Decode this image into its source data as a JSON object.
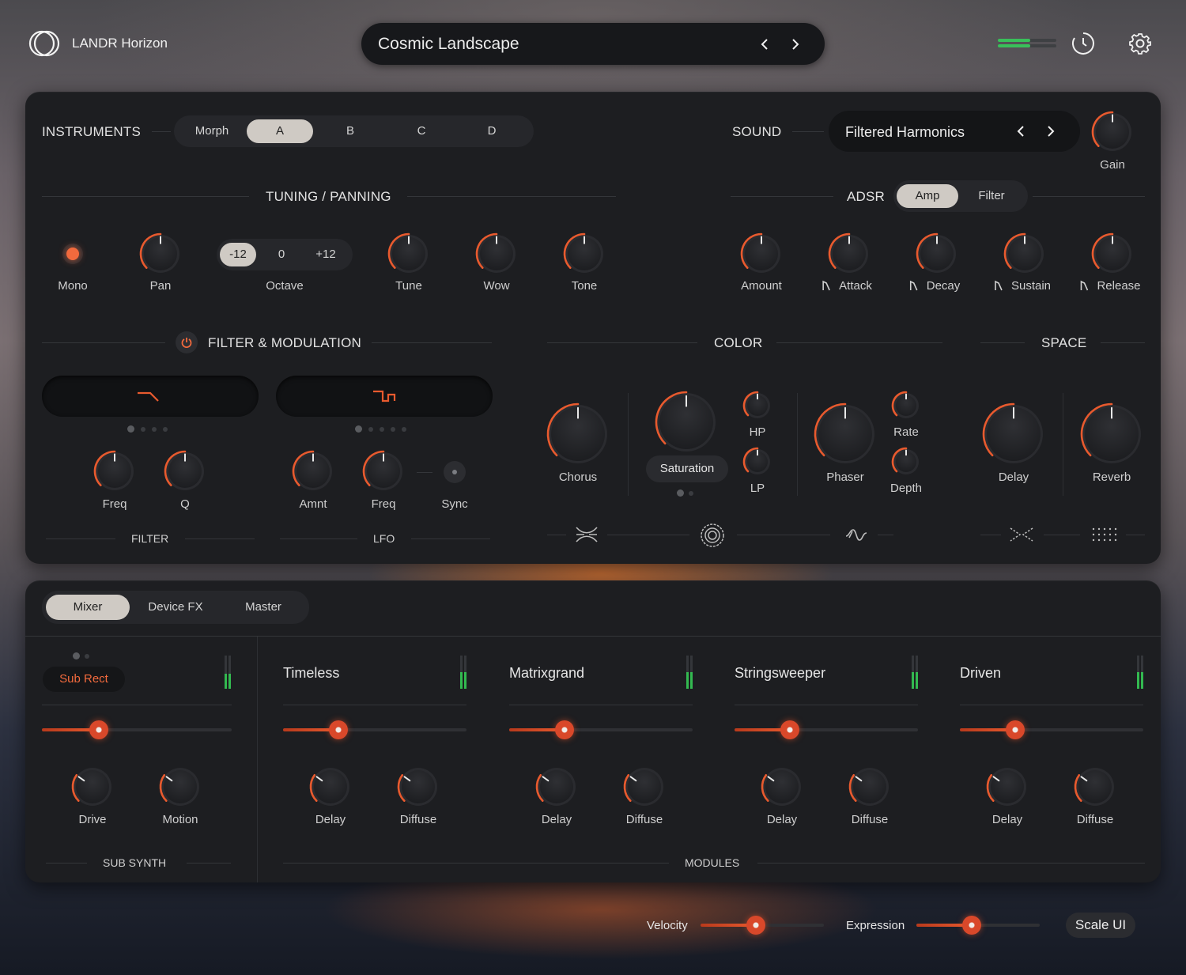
{
  "app": {
    "title": "LANDR Horizon"
  },
  "preset": {
    "name": "Cosmic Landscape"
  },
  "colors": {
    "accent": "#e85a2e",
    "meter": "#39c05a",
    "panel": "#1d1e21"
  },
  "top_meter": {
    "level": 0.55
  },
  "top_icons": {
    "history": "clock-icon",
    "settings": "gear-icon"
  },
  "instruments": {
    "label": "INSTRUMENTS",
    "tabs": [
      "Morph",
      "A",
      "B",
      "C",
      "D"
    ],
    "active": "A"
  },
  "sound": {
    "label": "SOUND",
    "name": "Filtered Harmonics",
    "gain_label": "Gain",
    "gain": 0.5
  },
  "tuning": {
    "label": "TUNING / PANNING",
    "mono_label": "Mono",
    "pan_label": "Pan",
    "octave_label": "Octave",
    "octave_options": [
      "-12",
      "0",
      "+12"
    ],
    "octave_active": "-12",
    "tune_label": "Tune",
    "wow_label": "Wow",
    "tone_label": "Tone",
    "pan": 0.5,
    "tune": 0.5,
    "wow": 0.5,
    "tone": 0.5
  },
  "adsr": {
    "label": "ADSR",
    "tabs": [
      "Amp",
      "Filter"
    ],
    "active": "Amp",
    "amount_label": "Amount",
    "attack_label": "Attack",
    "decay_label": "Decay",
    "sustain_label": "Sustain",
    "release_label": "Release",
    "amount": 0.5,
    "attack": 0.5,
    "decay": 0.5,
    "sustain": 0.5,
    "release": 0.5
  },
  "filter_mod": {
    "label": "FILTER & MODULATION",
    "filter_label": "FILTER",
    "lfo_label": "LFO",
    "freq_label": "Freq",
    "q_label": "Q",
    "amnt_label": "Amnt",
    "lfo_freq_label": "Freq",
    "sync_label": "Sync",
    "filter_freq": 0.5,
    "filter_q": 0.5,
    "lfo_amnt": 0.5,
    "lfo_freq": 0.5,
    "filter_pages": 4,
    "filter_page": 0,
    "lfo_pages": 5,
    "lfo_page": 0
  },
  "color": {
    "label": "COLOR",
    "chorus_label": "Chorus",
    "saturation_label": "Saturation",
    "hp_label": "HP",
    "lp_label": "LP",
    "phaser_label": "Phaser",
    "rate_label": "Rate",
    "depth_label": "Depth",
    "chorus": 0.5,
    "saturation": 0.5,
    "hp": 0.5,
    "lp": 0.5,
    "phaser": 0.5,
    "rate": 0.5,
    "depth": 0.5
  },
  "space": {
    "label": "SPACE",
    "delay_label": "Delay",
    "reverb_label": "Reverb",
    "delay": 0.5,
    "reverb": 0.5
  },
  "mixer": {
    "tabs": [
      "Mixer",
      "Device FX",
      "Master"
    ],
    "active": "Mixer",
    "sub_synth": {
      "section_label": "SUB SYNTH",
      "name": "Sub Rect",
      "drive_label": "Drive",
      "motion_label": "Motion",
      "level": 0.3,
      "meter": 0.45
    },
    "modules_label": "MODULES",
    "modules": [
      {
        "name": "Timeless",
        "delay_label": "Delay",
        "diffuse_label": "Diffuse",
        "level": 0.3,
        "meter": 0.5
      },
      {
        "name": "Matrixgrand",
        "delay_label": "Delay",
        "diffuse_label": "Diffuse",
        "level": 0.3,
        "meter": 0.5
      },
      {
        "name": "Stringsweeper",
        "delay_label": "Delay",
        "diffuse_label": "Diffuse",
        "level": 0.3,
        "meter": 0.5
      },
      {
        "name": "Driven",
        "delay_label": "Delay",
        "diffuse_label": "Diffuse",
        "level": 0.3,
        "meter": 0.5
      }
    ]
  },
  "footer": {
    "velocity_label": "Velocity",
    "velocity": 0.45,
    "expression_label": "Expression",
    "expression": 0.45,
    "scale_label": "Scale UI"
  }
}
